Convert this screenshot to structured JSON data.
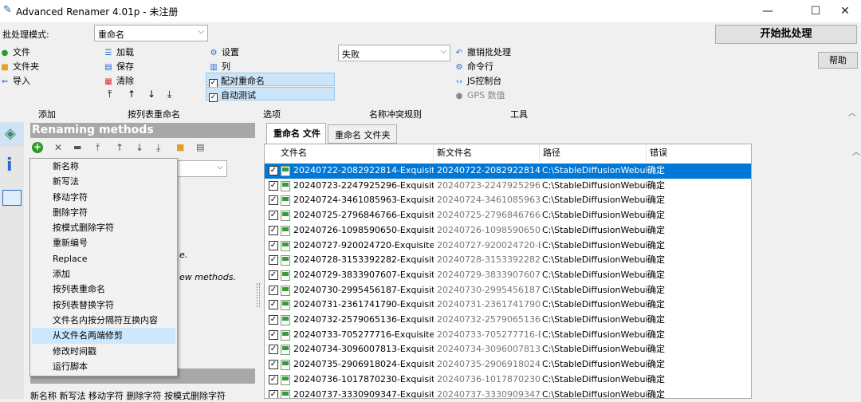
{
  "window": {
    "title": "Advanced Renamer 4.01p - 未注册",
    "min": "—",
    "max": "☐",
    "close": "✕"
  },
  "toolbar": {
    "batch_mode_label": "批处理模式:",
    "batch_mode_value": "重命名",
    "file": "文件",
    "folder": "文件夹",
    "import": "导入",
    "load": "加载",
    "save": "保存",
    "clear": "清除",
    "settings": "设置",
    "columns": "列",
    "pair_rename": "配对重命名",
    "auto_test": "自动测试",
    "conflict_value": "失败",
    "undo_batch": "撤销批处理",
    "cmdline": "命令行",
    "js_console": "JS控制台",
    "gps": "GPS 数值",
    "start_batch": "开始批处理",
    "help": "帮助",
    "groups": {
      "add": "添加",
      "list_rename": "按列表重命名",
      "options": "选项",
      "conflict_rule": "名称冲突规则",
      "tools": "工具"
    }
  },
  "methods": {
    "header": "Renaming methods",
    "hint1": "e.",
    "hint2": "ew methods.",
    "bottom_items": "新名称  新写法  移动字符  删除字符  按模式删除字符",
    "menu": [
      "新名称",
      "新写法",
      "移动字符",
      "删除字符",
      "按模式删除字符",
      "重新编号",
      "Replace",
      "添加",
      "按列表重命名",
      "按列表替换字符",
      "文件名内按分隔符互换内容",
      "从文件名两端修剪",
      "修改时间戳",
      "运行脚本"
    ],
    "selected_index": 11
  },
  "tabs": {
    "files": "重命名 文件",
    "folders": "重命名 文件夹"
  },
  "table": {
    "headers": {
      "filename": "文件名",
      "newname": "新文件名",
      "path": "路径",
      "error": "错误"
    },
    "rows": [
      {
        "name": "20240722-2082922814-Exquisite ...",
        "new": "20240722-2082922814-...",
        "path": "C:\\StableDiffusionWebui...",
        "err": "确定",
        "selected": true
      },
      {
        "name": "20240723-2247925296-Exquisite ...",
        "new": "20240723-2247925296-...",
        "path": "C:\\StableDiffusionWebui...",
        "err": "确定"
      },
      {
        "name": "20240724-3461085963-Exquisite ...",
        "new": "20240724-3461085963-...",
        "path": "C:\\StableDiffusionWebui...",
        "err": "确定"
      },
      {
        "name": "20240725-2796846766-Exquisite ...",
        "new": "20240725-2796846766-...",
        "path": "C:\\StableDiffusionWebui...",
        "err": "确定"
      },
      {
        "name": "20240726-1098590650-Exquisite ...",
        "new": "20240726-1098590650-...",
        "path": "C:\\StableDiffusionWebui...",
        "err": "确定"
      },
      {
        "name": "20240727-920024720-Exquisite f...",
        "new": "20240727-920024720-E...",
        "path": "C:\\StableDiffusionWebui...",
        "err": "确定"
      },
      {
        "name": "20240728-3153392282-Exquisite ...",
        "new": "20240728-3153392282-...",
        "path": "C:\\StableDiffusionWebui...",
        "err": "确定"
      },
      {
        "name": "20240729-3833907607-Exquisite ...",
        "new": "20240729-3833907607-...",
        "path": "C:\\StableDiffusionWebui...",
        "err": "确定"
      },
      {
        "name": "20240730-2995456187-Exquisite ...",
        "new": "20240730-2995456187-...",
        "path": "C:\\StableDiffusionWebui...",
        "err": "确定"
      },
      {
        "name": "20240731-2361741790-Exquisite ...",
        "new": "20240731-2361741790-...",
        "path": "C:\\StableDiffusionWebui...",
        "err": "确定"
      },
      {
        "name": "20240732-2579065136-Exquisite ...",
        "new": "20240732-2579065136-...",
        "path": "C:\\StableDiffusionWebui...",
        "err": "确定"
      },
      {
        "name": "20240733-705277716-Exquisite f...",
        "new": "20240733-705277716-E...",
        "path": "C:\\StableDiffusionWebui...",
        "err": "确定"
      },
      {
        "name": "20240734-3096007813-Exquisite ...",
        "new": "20240734-3096007813-...",
        "path": "C:\\StableDiffusionWebui...",
        "err": "确定"
      },
      {
        "name": "20240735-2906918024-Exquisite ...",
        "new": "20240735-2906918024-...",
        "path": "C:\\StableDiffusionWebui...",
        "err": "确定"
      },
      {
        "name": "20240736-1017870230-Exquisite ...",
        "new": "20240736-1017870230-...",
        "path": "C:\\StableDiffusionWebui...",
        "err": "确定"
      },
      {
        "name": "20240737-3330909347-Exquisite ...",
        "new": "20240737-3330909347-...",
        "path": "C:\\StableDiffusionWebui...",
        "err": "确定"
      }
    ]
  },
  "colors": {
    "selection": "#0078d7",
    "menu_highlight": "#cce8ff",
    "methods_header": "#a8a8a8"
  }
}
